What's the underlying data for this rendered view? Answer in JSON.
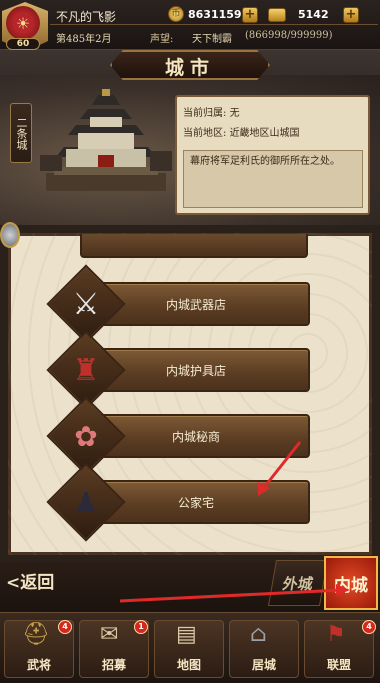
{
  "player": {
    "name": "不凡的飞影",
    "level": "60",
    "date": "第485年2月",
    "prestige_label": "声望:",
    "prestige_title": "天下制霸",
    "prestige_value": "(866998/999999)"
  },
  "currency": {
    "gold": "8631159",
    "ingot": "5142"
  },
  "header": {
    "title": "城市",
    "city_name": "二条城",
    "owner_label": "当前归属:",
    "owner_value": "无",
    "region_label": "当前地区:",
    "region_value": "近畿地区山城国",
    "description": "幕府将军足利氏的御所所在之处。"
  },
  "list": {
    "items": [
      {
        "label": "内城武器店"
      },
      {
        "label": "内城护具店"
      },
      {
        "label": "内城秘商"
      },
      {
        "label": "公家宅"
      }
    ]
  },
  "footer": {
    "back_label": "<返回",
    "tab_outer": "外城",
    "tab_inner": "内城"
  },
  "nav": {
    "items": [
      {
        "label": "武将",
        "badge": "4"
      },
      {
        "label": "招募",
        "badge": "1"
      },
      {
        "label": "地图"
      },
      {
        "label": "居城"
      },
      {
        "label": "联盟",
        "badge": "4"
      }
    ]
  },
  "colors": {
    "annotation_arrow": "#e02a2a"
  }
}
